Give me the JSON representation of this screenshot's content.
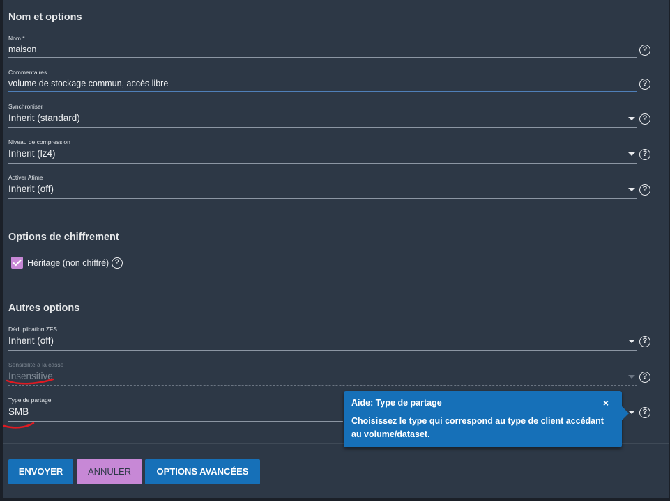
{
  "sections": {
    "name_options": "Nom et options",
    "encryption": "Options de chiffrement",
    "other": "Autres options"
  },
  "fields": {
    "name": {
      "label": "Nom *",
      "value": "maison"
    },
    "comments": {
      "label": "Commentaires",
      "value": "volume de stockage commun, accès libre"
    },
    "sync": {
      "label": "Synchroniser",
      "value": "Inherit (standard)"
    },
    "compression": {
      "label": "Niveau de compression",
      "value": "Inherit (lz4)"
    },
    "atime": {
      "label": "Activer Atime",
      "value": "Inherit (off)"
    },
    "dedup": {
      "label": "Déduplication ZFS",
      "value": "Inherit (off)"
    },
    "case": {
      "label": "Sensibilité à la casse",
      "value": "Insensitive"
    },
    "share_type": {
      "label": "Type de partage",
      "value": "SMB"
    }
  },
  "encryption": {
    "checkbox_label": "Héritage (non chiffré)",
    "checked": true
  },
  "tooltip": {
    "title": "Aide: Type de partage",
    "close": "×",
    "body": "Choisissez le type qui correspond au type de client accédant au volume/dataset."
  },
  "buttons": {
    "submit": "ENVOYER",
    "cancel": "ANNULER",
    "advanced": "OPTIONS AVANCÉES"
  },
  "help_glyph": "?",
  "colors": {
    "panel_bg": "#2d3846",
    "primary": "#1670b8",
    "accent": "#c788d6",
    "annotation": "#e01a22"
  }
}
